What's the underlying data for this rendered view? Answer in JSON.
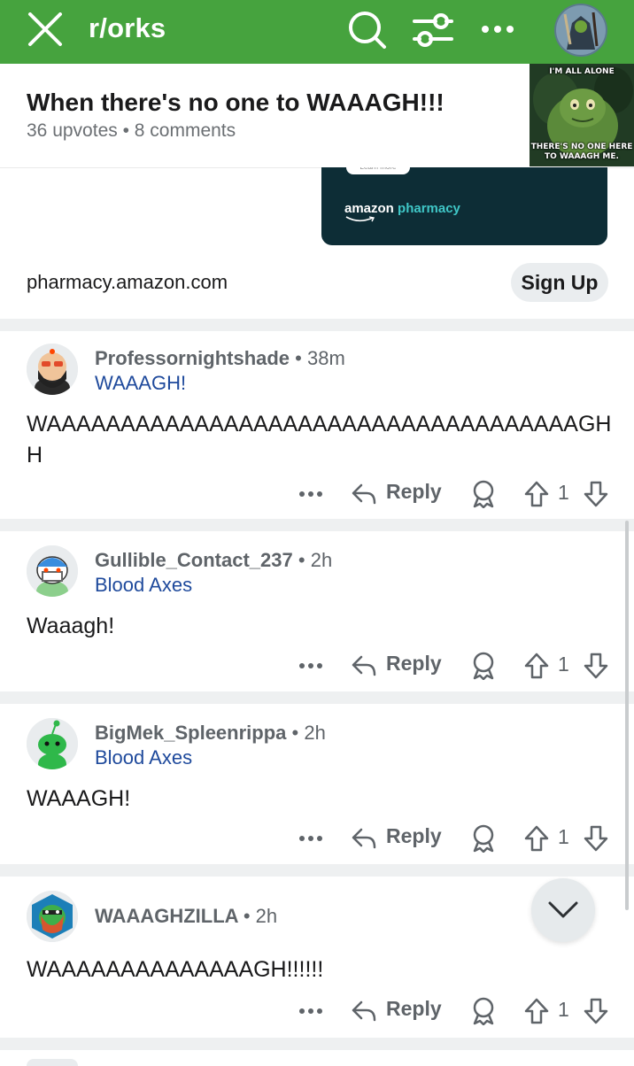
{
  "topbar": {
    "title": "r/orks",
    "bg_color": "#46a33e",
    "icons": [
      "close-icon",
      "search-icon",
      "filter-icon",
      "more-icon",
      "avatar"
    ]
  },
  "post": {
    "title": "When there's no one to WAAAGH!!!",
    "meta": "36 upvotes • 8 comments",
    "thumbnail": {
      "caption_top": "I'M ALL ALONE",
      "caption_bottom_1": "THERE'S NO ONE HERE",
      "caption_bottom_2": "TO WAAAGH ME."
    }
  },
  "ad": {
    "image_button": "Learn more",
    "brand": "amazon",
    "brand_product": "pharmacy",
    "domain": "pharmacy.amazon.com",
    "cta": "Sign Up"
  },
  "comments": [
    {
      "author": "Professornightshade",
      "age": "38m",
      "flair": "WAAAGH!",
      "body": "WAAAAAAAAAAAAAAAAAAAAAAAAAAAAAAAAAAAAGHH",
      "reply_label": "Reply",
      "votes": "1"
    },
    {
      "author": "Gullible_Contact_237",
      "age": "2h",
      "flair": "Blood Axes",
      "body": "Waaagh!",
      "reply_label": "Reply",
      "votes": "1"
    },
    {
      "author": "BigMek_Spleenrippa",
      "age": "2h",
      "flair": "Blood Axes",
      "body": "WAAAGH!",
      "reply_label": "Reply",
      "votes": "1"
    },
    {
      "author": "WAAAGHZILLA",
      "age": "2h",
      "flair": "",
      "body": "WAAAAAAAAAAAAAAGH!!!!!!",
      "reply_label": "Reply",
      "votes": "1"
    }
  ],
  "separator": "•",
  "colors": {
    "accent": "#46a33e",
    "flair": "#1f4a9c",
    "meta": "#6b6f73",
    "ad_bg": "#0d2d36"
  }
}
